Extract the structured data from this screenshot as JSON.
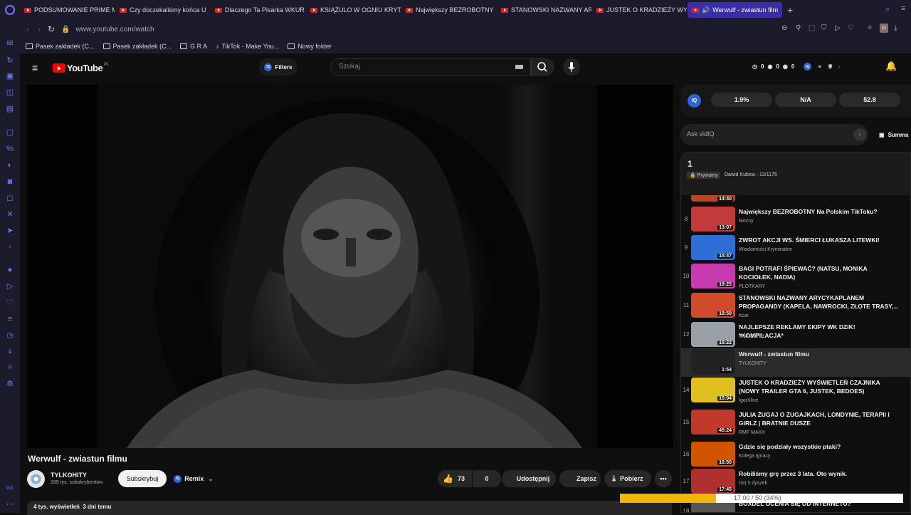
{
  "browser": {
    "tabs": [
      {
        "label": "PODSUMOWANIE PRIME M"
      },
      {
        "label": "Czy doczekaliśmy końca U"
      },
      {
        "label": "Dlaczego Ta Pisarka WKUR"
      },
      {
        "label": "KSIĄŻULO W OGNIU KRYT"
      },
      {
        "label": "Największy BEZROBOTNY"
      },
      {
        "label": "STANOWSKI NAZWANY AR"
      },
      {
        "label": "JUSTEK O KRADZIEŻY WY"
      },
      {
        "label": "Werwulf - zwiastun film"
      }
    ],
    "new_tab": "+",
    "url": "www.youtube.com/watch",
    "bookmarks": [
      {
        "label": "Pasek zakładek (C..."
      },
      {
        "label": "Pasek zakładek (C..."
      },
      {
        "label": "G R A"
      },
      {
        "label": "TikTok - Make You..."
      },
      {
        "label": "Nowy folder"
      }
    ],
    "profile_badge": "D"
  },
  "youtube": {
    "logo_text": "YouTube",
    "logo_region": "PL",
    "filters_label": "Filters",
    "search_placeholder": "Szukaj",
    "ext_counters": [
      "0",
      "0",
      "0"
    ],
    "video": {
      "title": "Werwulf - zwiastun filmu",
      "channel": "TYLKOHITY",
      "subscribers": "189 tys. subskrybentów",
      "subscribe_label": "Subskrybuj",
      "remix_label": "Remix",
      "likes": "73",
      "dislikes": "0",
      "share_label": "Udostępnij",
      "save_label": "Zapisz",
      "download_label": "Pobierz",
      "meta": "4 tys. wyświetleń  3 dni temu"
    },
    "vidiq": {
      "stat1": "1.9%",
      "stat2": "N/A",
      "stat3": "52.8",
      "ask_placeholder": "Ask vidIQ",
      "summary_label": "Summa"
    },
    "playlist": {
      "title": "1",
      "privacy": "Prywatny",
      "owner_index": "Dawid Kubica - 13/1175",
      "partial_duration": "14:40",
      "items": [
        {
          "num": "8",
          "title": "Największy BEZROBOTNY Na Polskim TikToku?",
          "channel": "Mocny",
          "duration": "13:07"
        },
        {
          "num": "9",
          "title": "ZWROT AKCJI WS. ŚMIERCI ŁUKASZA LITEWKI!",
          "channel": "Wiadomości Kryminalne",
          "duration": "15:47"
        },
        {
          "num": "10",
          "title": "BAGI POTRAFI ŚPIEWAĆ? (NATSU, MONIKA KOCIOŁEK, NADIA)",
          "channel": "PLOTKARY",
          "duration": "19:25"
        },
        {
          "num": "11",
          "title": "STANOWSKI NAZWANY ARYCYKAPLANEM PROPAGANDY (KAPELA, NAWROCKI, ZŁOTE TRASY,...",
          "channel": "Kozi",
          "duration": "18:59"
        },
        {
          "num": "12",
          "title": "NAJLEPSZE REKLAMY EKIPY WK DZIK! *KOMPILACJA*",
          "channel": "WKDZIK PL",
          "duration": "15:22"
        },
        {
          "num": "",
          "title": "Werwulf - zwiastun filmu",
          "channel": "TYLKOHITY",
          "duration": "1:54"
        },
        {
          "num": "14",
          "title": "JUSTEK O KRADZIEŻY WYŚWIETLEŃ CZAJNIKA (NOWY TRAILER GTA 6, JUSTEK, BEDOES)",
          "channel": "IgorXlive",
          "duration": "15:04"
        },
        {
          "num": "15",
          "title": "JULIA ŻUGAJ O ŻUGAJKACH, LONDYNIE, TERAPII I GIRLZ | BRATNIE DUSZE",
          "channel": "RMF MAXX",
          "duration": "45:24"
        },
        {
          "num": "16",
          "title": "Gdzie się podziały wszystkie ptaki?",
          "channel": "Kolega Ignacy",
          "duration": "16:50"
        },
        {
          "num": "17",
          "title": "Robiliśmy grę przez 3 lata. Oto wynik.",
          "channel": "Dej 5 dyszek",
          "duration": "17:45"
        },
        {
          "num": "18",
          "title": "BOXDEL OCENIA SIĘ OD INTERNETU?",
          "channel": "",
          "duration": ""
        }
      ]
    },
    "overlay_progress": {
      "text": "17.00 / 50 (34%)",
      "percent": 34
    }
  },
  "colors": {
    "accent": "#3a2ea8",
    "youtube_red": "#ff0000",
    "vidiq_blue": "#2d65d6",
    "progress_yellow": "#f2b705"
  }
}
